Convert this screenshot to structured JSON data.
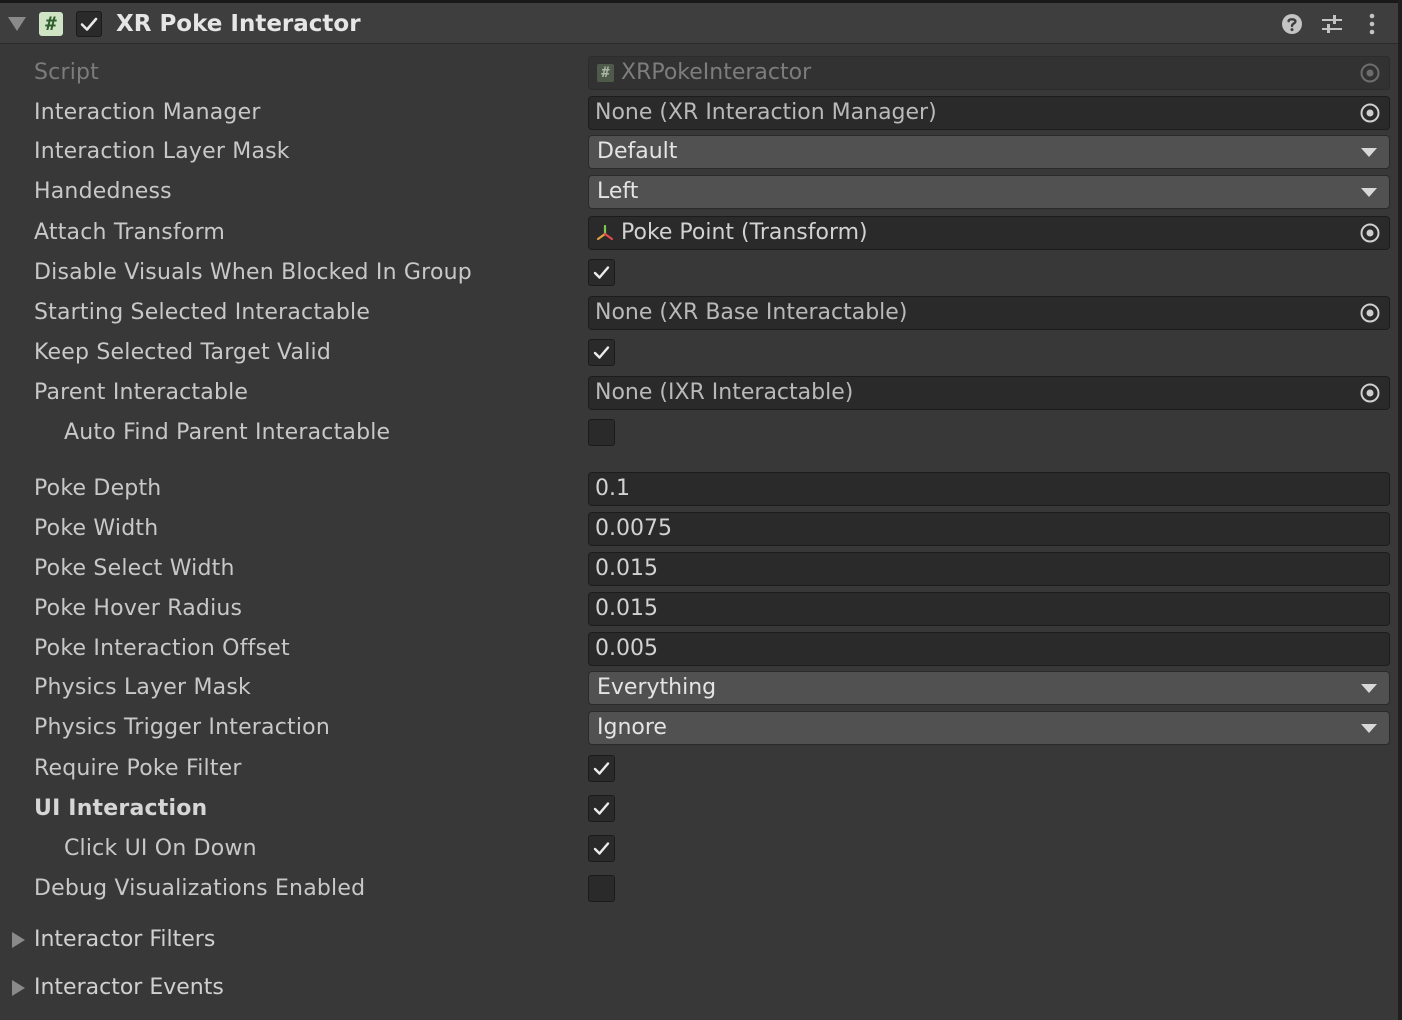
{
  "component": {
    "title": "XR Poke Interactor",
    "enabled": true,
    "icons": {
      "script": "#",
      "help": "help-icon",
      "presets": "presets-icon",
      "menu": "kebab-menu-icon"
    }
  },
  "fields": {
    "script": {
      "label": "Script",
      "value": "XRPokeInteractor"
    },
    "interaction_manager": {
      "label": "Interaction Manager",
      "value": "None (XR Interaction Manager)"
    },
    "interaction_layer_mask": {
      "label": "Interaction Layer Mask",
      "value": "Default"
    },
    "handedness": {
      "label": "Handedness",
      "value": "Left"
    },
    "attach_transform": {
      "label": "Attach Transform",
      "value": "Poke Point (Transform)"
    },
    "disable_visuals": {
      "label": "Disable Visuals When Blocked In Group",
      "checked": true
    },
    "starting_selected": {
      "label": "Starting Selected Interactable",
      "value": "None (XR Base Interactable)"
    },
    "keep_selected": {
      "label": "Keep Selected Target Valid",
      "checked": true
    },
    "parent_interactable": {
      "label": "Parent Interactable",
      "value": "None (IXR Interactable)"
    },
    "auto_find_parent": {
      "label": "Auto Find Parent Interactable",
      "checked": false
    },
    "poke_depth": {
      "label": "Poke Depth",
      "value": "0.1"
    },
    "poke_width": {
      "label": "Poke Width",
      "value": "0.0075"
    },
    "poke_select_width": {
      "label": "Poke Select Width",
      "value": "0.015"
    },
    "poke_hover_radius": {
      "label": "Poke Hover Radius",
      "value": "0.015"
    },
    "poke_interaction_offset": {
      "label": "Poke Interaction Offset",
      "value": "0.005"
    },
    "physics_layer_mask": {
      "label": "Physics Layer Mask",
      "value": "Everything"
    },
    "physics_trigger": {
      "label": "Physics Trigger Interaction",
      "value": "Ignore"
    },
    "require_poke_filter": {
      "label": "Require Poke Filter",
      "checked": true
    },
    "ui_interaction": {
      "label": "UI Interaction",
      "checked": true
    },
    "click_ui_on_down": {
      "label": "Click UI On Down",
      "checked": true
    },
    "debug_visualizations": {
      "label": "Debug Visualizations Enabled",
      "checked": false
    }
  },
  "sections": {
    "interactor_filters": "Interactor Filters",
    "interactor_events": "Interactor Events"
  },
  "colors": {
    "background": "#383838",
    "field": "#2a2a2a",
    "dropdown": "#515151",
    "text": "#c8c8c8"
  }
}
